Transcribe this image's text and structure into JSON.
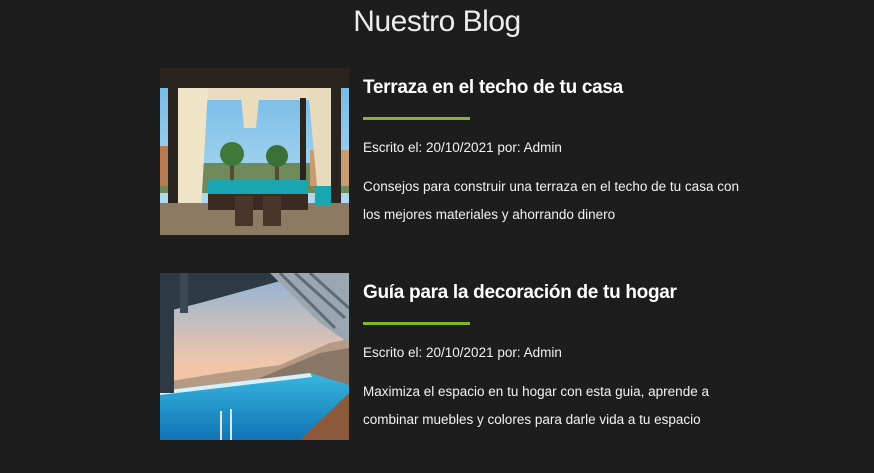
{
  "blog": {
    "title": "Nuestro Blog",
    "posts": [
      {
        "title": "Terraza en el techo de tu casa",
        "meta": "Escrito el: 20/10/2021 por: Admin",
        "excerpt": "Consejos para construir una terraza en el techo de tu casa con los mejores materiales y ahorrando dinero"
      },
      {
        "title": "Guía para la decoración de tu hogar",
        "meta": "Escrito el: 20/10/2021 por: Admin",
        "excerpt": "Maximiza el espacio en tu hogar con esta guia, aprende a combinar muebles y colores para darle vida a tu espacio"
      }
    ]
  },
  "colors": {
    "background": "#1d1d1d",
    "accent": "#7dba2b",
    "text": "#ffffff"
  }
}
